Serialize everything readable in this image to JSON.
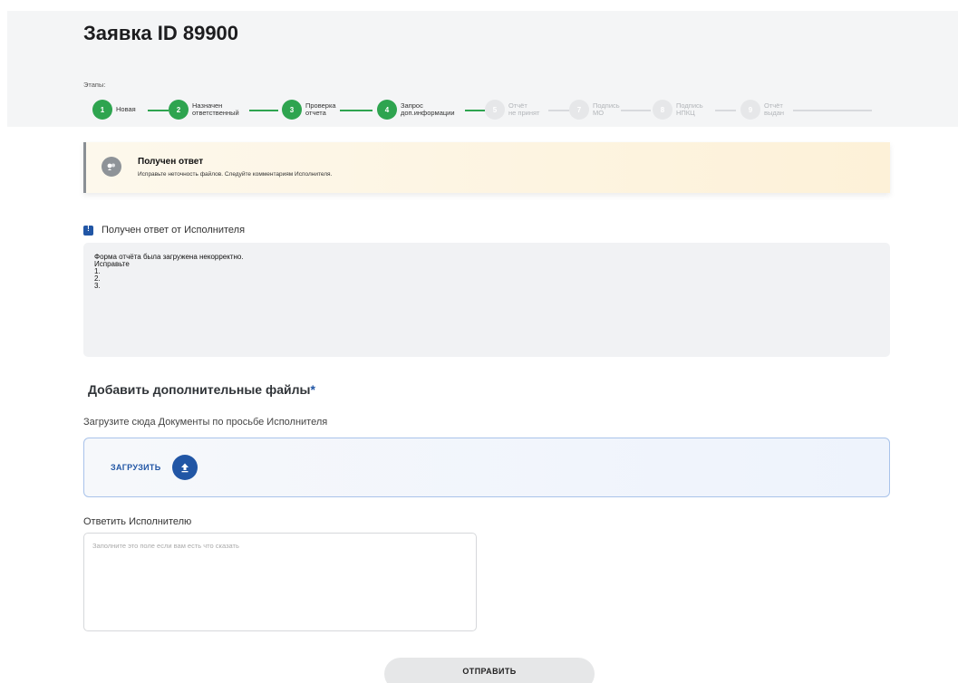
{
  "page": {
    "title": "Заявка ID 89900"
  },
  "stages": {
    "label": "Этапы:",
    "items": [
      {
        "num": "1",
        "label": "Новая",
        "status": "done"
      },
      {
        "num": "2",
        "label": "Назначен\nответственный",
        "status": "done"
      },
      {
        "num": "3",
        "label": "Проверка\nотчета",
        "status": "done"
      },
      {
        "num": "4",
        "label": "Запрос\nдоп.информации",
        "status": "done"
      },
      {
        "num": "5",
        "label": "Отчёт\nне принят",
        "status": "pending"
      },
      {
        "num": "7",
        "label": "Подпись\nМО",
        "status": "pending"
      },
      {
        "num": "8",
        "label": "Подпись\nНПКЦ",
        "status": "pending"
      },
      {
        "num": "9",
        "label": "Отчёт\nвыдан",
        "status": "pending"
      }
    ],
    "colors": {
      "done": "#2ea44f",
      "pending": "#e6e7e9"
    }
  },
  "alert": {
    "title": "Получен ответ",
    "text": "Исправьте неточность файлов. Следуйте комментариям Исполнителя.",
    "icon": "message-icon"
  },
  "response": {
    "title": "Получен ответ от Исполнителя",
    "icon": "alert-message-icon",
    "lines": [
      "Форма отчёта была загружена некорректно.",
      "Исправьте",
      "1.",
      "2.",
      "3."
    ]
  },
  "files": {
    "title": "Добавить дополнительные файлы",
    "required_mark": "*",
    "hint": "Загрузите сюда Документы по просьбе Исполнителя",
    "upload_label": "ЗАГРУЗИТЬ",
    "upload_icon": "upload-icon"
  },
  "reply": {
    "label": "Ответить Исполнителю",
    "placeholder": "Заполните это поле если вам есть что сказать",
    "value": ""
  },
  "submit": {
    "label": "ОТПРАВИТЬ"
  },
  "colors": {
    "accent": "#2156a5",
    "success": "#2ea44f",
    "alert_bg": "#fdf4e0"
  }
}
